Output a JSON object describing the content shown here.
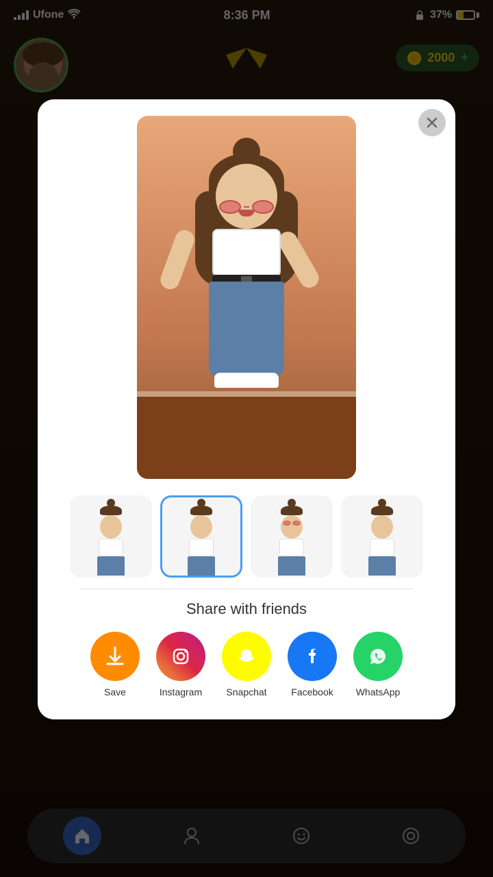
{
  "statusBar": {
    "carrier": "Ufone",
    "time": "8:36 PM",
    "battery": "37%",
    "wifi": true
  },
  "gameUI": {
    "coins": "2000"
  },
  "modal": {
    "closeButton": "×",
    "thumbnails": [
      {
        "id": 1,
        "active": false
      },
      {
        "id": 2,
        "active": true
      },
      {
        "id": 3,
        "active": false
      },
      {
        "id": 4,
        "active": false
      }
    ],
    "shareTitle": "Share with friends",
    "shareButtons": [
      {
        "id": "save",
        "label": "Save",
        "icon": "⬇"
      },
      {
        "id": "instagram",
        "label": "Instagram",
        "icon": "📷"
      },
      {
        "id": "snapchat",
        "label": "Snapchat",
        "icon": "👻"
      },
      {
        "id": "facebook",
        "label": "Facebook",
        "icon": "f"
      },
      {
        "id": "whatsapp",
        "label": "WhatsApp",
        "icon": "💬"
      }
    ]
  },
  "bottomNav": [
    {
      "id": "home",
      "icon": "⌂",
      "active": true
    },
    {
      "id": "friends",
      "icon": "👤",
      "active": false
    },
    {
      "id": "emoji",
      "icon": "☺",
      "active": false
    },
    {
      "id": "camera",
      "icon": "◎",
      "active": false
    }
  ]
}
